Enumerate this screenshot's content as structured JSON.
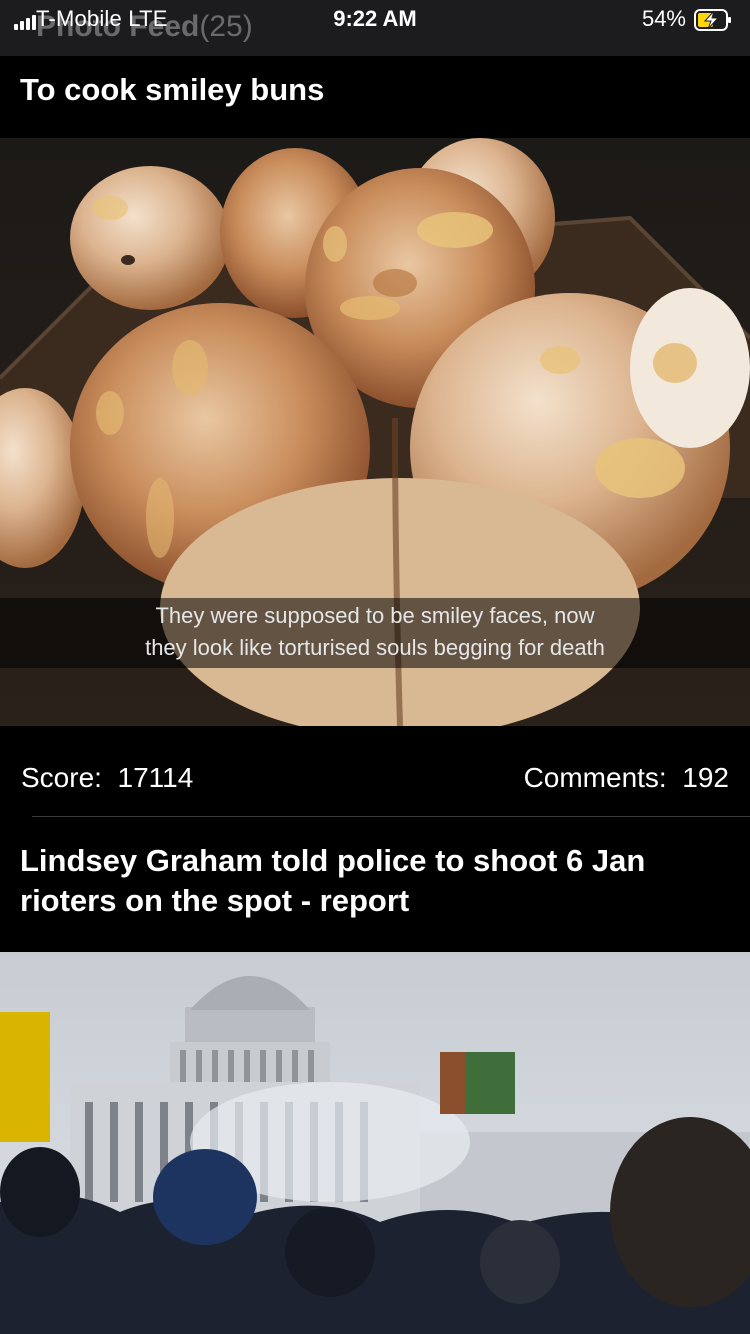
{
  "status_bar": {
    "carrier": "T-Mobile  LTE",
    "time": "9:22 AM",
    "battery": "54%",
    "icons": [
      "signal-icon",
      "battery-charging-icon"
    ]
  },
  "nav": {
    "title": "Photo Feed",
    "count": "(25)"
  },
  "posts": [
    {
      "title": "To cook smiley buns",
      "image_caption_line1": "They were supposed to be smiley faces, now",
      "image_caption_line2": "they look like torturised souls begging for death",
      "score_label": "Score:",
      "score": "17114",
      "comments_label": "Comments:",
      "comments": "192"
    },
    {
      "title_line1": "Lindsey Graham told police to shoot 6 Jan",
      "title_line2": "rioters on the spot - report"
    }
  ],
  "colors": {
    "background": "#000000",
    "status_bar": "#1c1c1e",
    "text": "#ffffff",
    "divider": "#3a3a3c"
  }
}
